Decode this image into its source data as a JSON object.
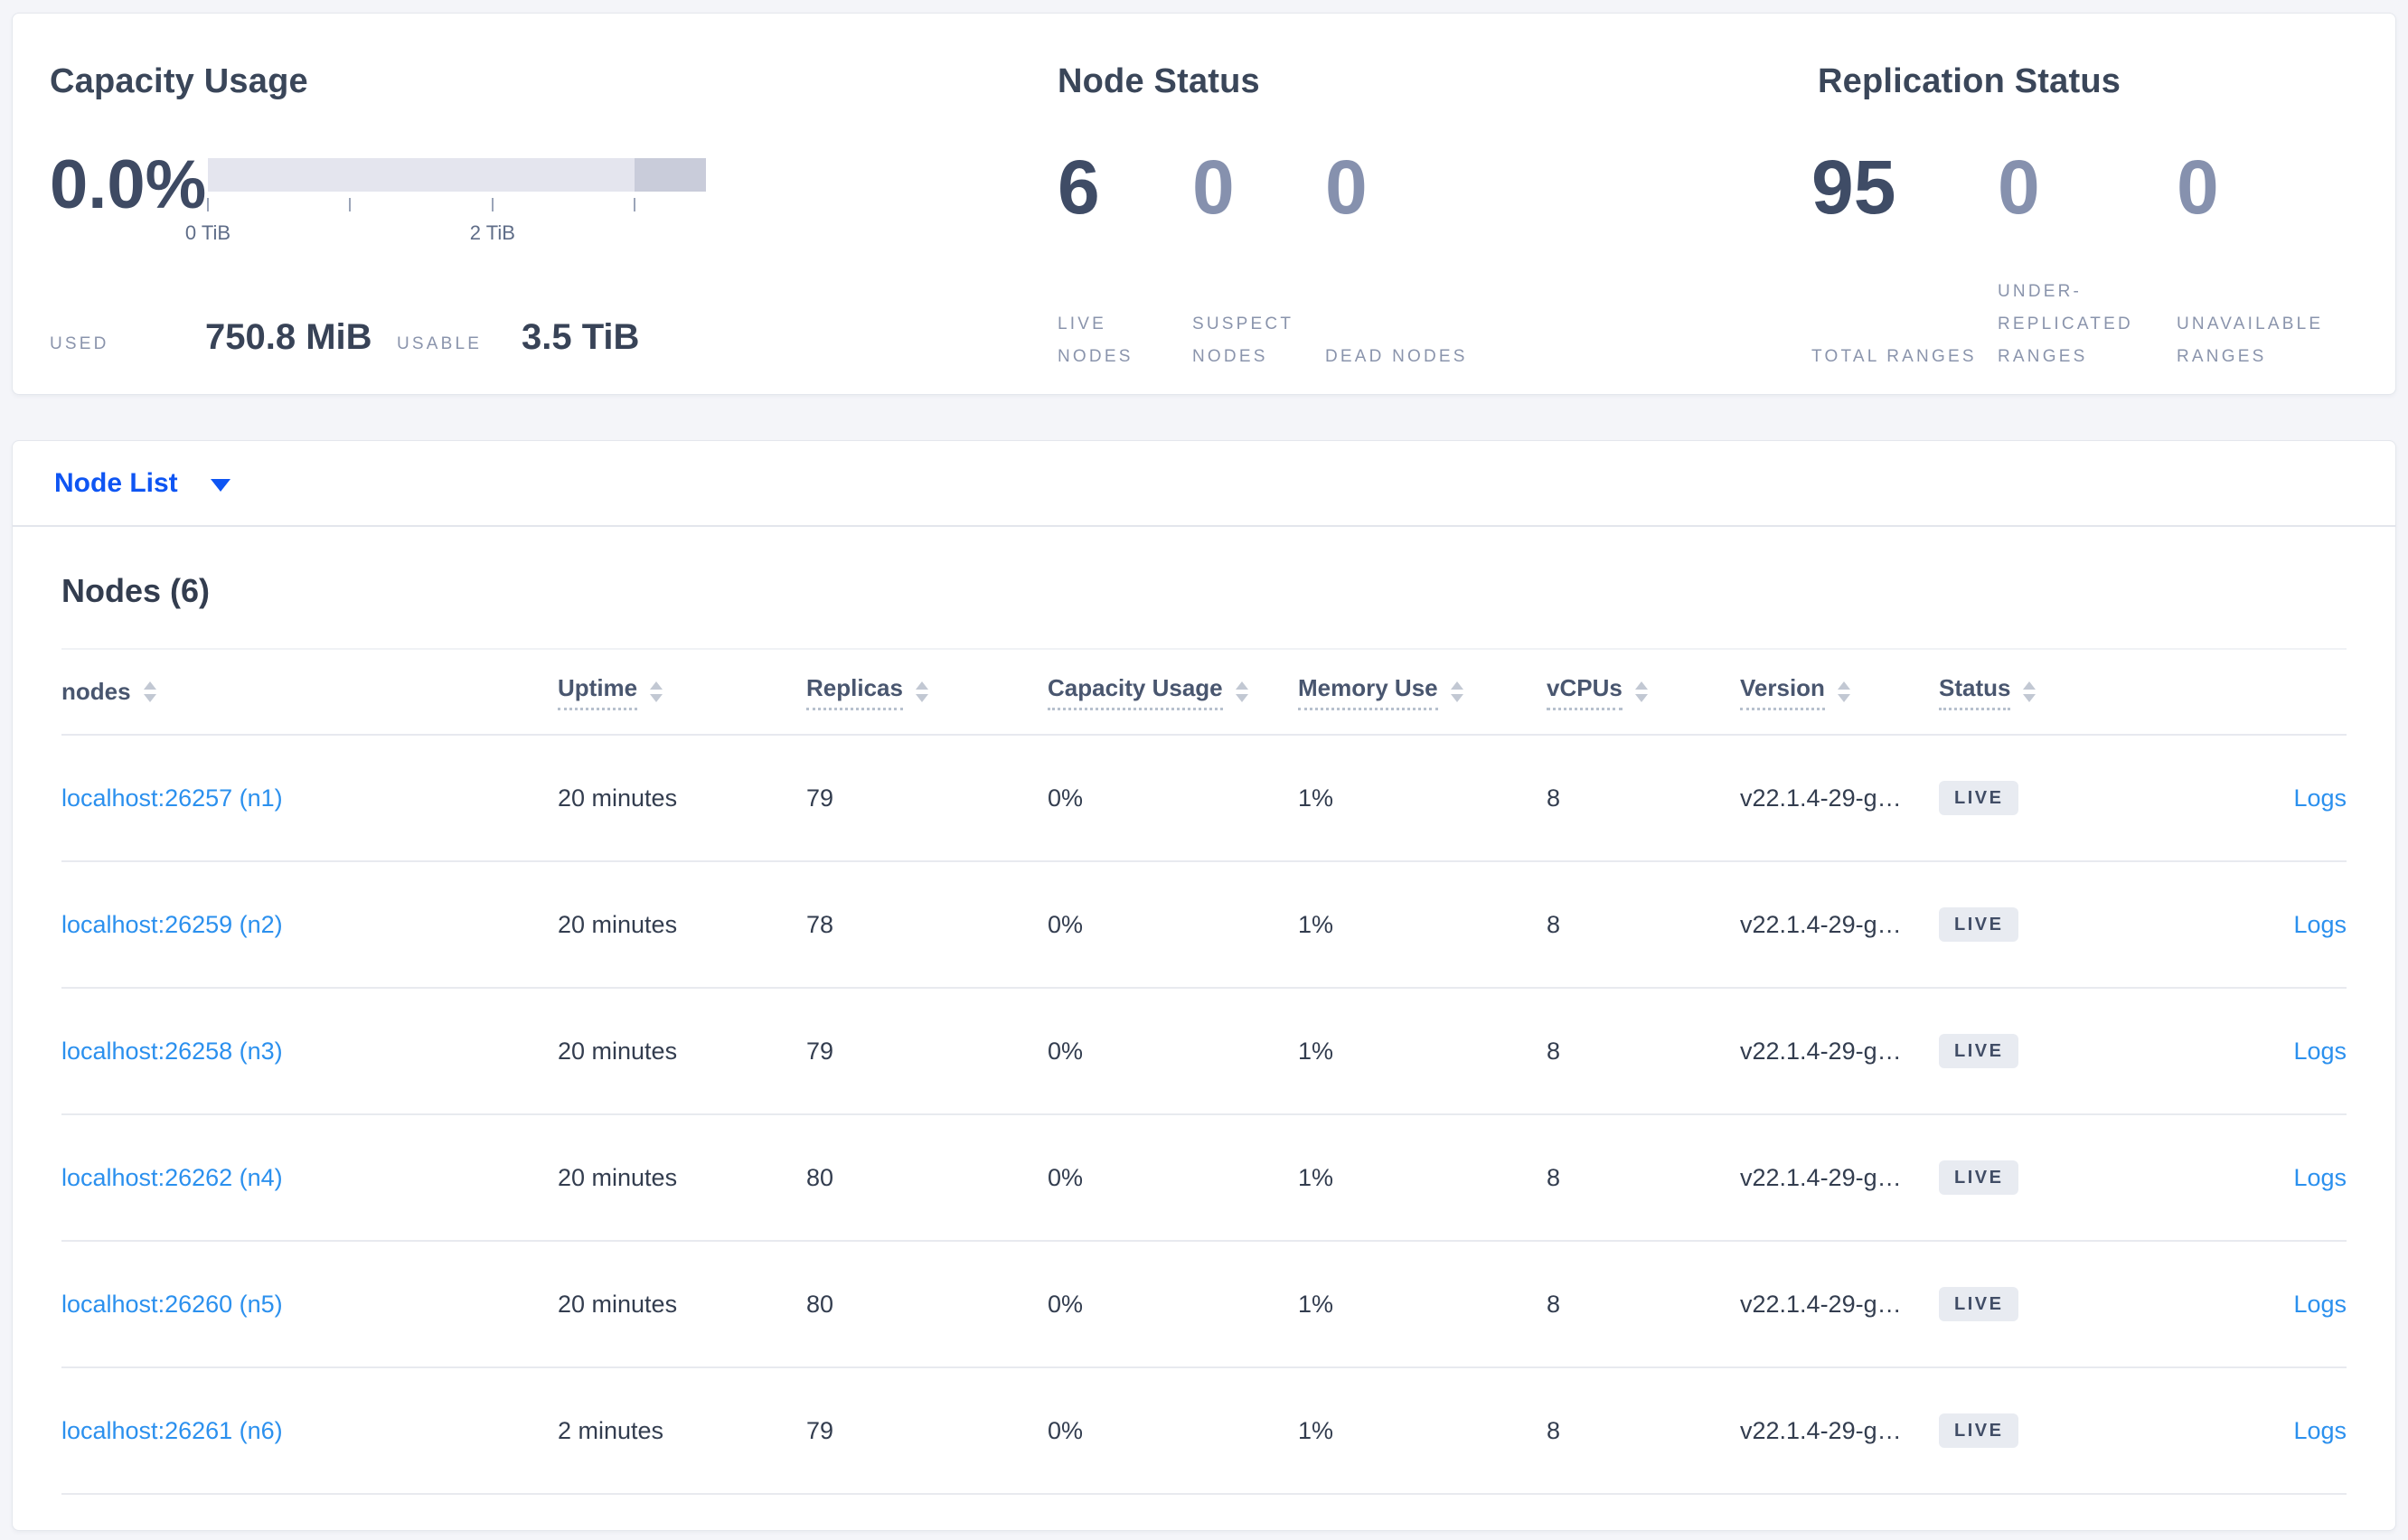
{
  "colors": {
    "accent_blue": "#0e55f3",
    "link_blue": "#2b90ee",
    "dark_number": "#3f4c66",
    "light_number": "#8691ae",
    "gauge_track": "#e4e5ee",
    "gauge_extra": "#c9ccda",
    "badge_bg": "#e8ebf1",
    "badge_text": "#414d66"
  },
  "summary": {
    "capacity": {
      "title": "Capacity Usage",
      "percent": "0.0%",
      "gauge": {
        "total_tib": 3.5,
        "extra_from_tib": 3.0,
        "ticks": [
          {
            "tib": 0,
            "label": "0 TiB"
          },
          {
            "tib": 1,
            "label": ""
          },
          {
            "tib": 2,
            "label": "2 TiB"
          },
          {
            "tib": 3,
            "label": ""
          }
        ]
      },
      "used_label": "USED",
      "used_value": "750.8 MiB",
      "usable_label": "USABLE",
      "usable_value": "3.5 TiB"
    },
    "node_status": {
      "title": "Node Status",
      "metrics": [
        {
          "value": "6",
          "label": "LIVE NODES",
          "emphasis": "dark"
        },
        {
          "value": "0",
          "label": "SUSPECT NODES",
          "emphasis": "light"
        },
        {
          "value": "0",
          "label": "DEAD NODES",
          "emphasis": "light"
        }
      ]
    },
    "replication_status": {
      "title": "Replication Status",
      "metrics": [
        {
          "value": "95",
          "label": "TOTAL RANGES",
          "emphasis": "dark"
        },
        {
          "value": "0",
          "label": "UNDER-REPLICATED RANGES",
          "emphasis": "light"
        },
        {
          "value": "0",
          "label": "UNAVAILABLE RANGES",
          "emphasis": "light"
        }
      ]
    }
  },
  "view_selector": {
    "label": "Node List"
  },
  "table": {
    "title": "Nodes (6)",
    "logs_label": "Logs",
    "columns": [
      {
        "label": "nodes",
        "underlined": false
      },
      {
        "label": "Uptime",
        "underlined": true
      },
      {
        "label": "Replicas",
        "underlined": true
      },
      {
        "label": "Capacity Usage",
        "underlined": true
      },
      {
        "label": "Memory Use",
        "underlined": true
      },
      {
        "label": "vCPUs",
        "underlined": true
      },
      {
        "label": "Version",
        "underlined": true
      },
      {
        "label": "Status",
        "underlined": true
      }
    ],
    "rows": [
      {
        "node": "localhost:26257 (n1)",
        "uptime": "20 minutes",
        "replicas": "79",
        "capacity": "0%",
        "memory": "1%",
        "vcpus": "8",
        "version": "v22.1.4-29-g…",
        "status": "LIVE"
      },
      {
        "node": "localhost:26259 (n2)",
        "uptime": "20 minutes",
        "replicas": "78",
        "capacity": "0%",
        "memory": "1%",
        "vcpus": "8",
        "version": "v22.1.4-29-g…",
        "status": "LIVE"
      },
      {
        "node": "localhost:26258 (n3)",
        "uptime": "20 minutes",
        "replicas": "79",
        "capacity": "0%",
        "memory": "1%",
        "vcpus": "8",
        "version": "v22.1.4-29-g…",
        "status": "LIVE"
      },
      {
        "node": "localhost:26262 (n4)",
        "uptime": "20 minutes",
        "replicas": "80",
        "capacity": "0%",
        "memory": "1%",
        "vcpus": "8",
        "version": "v22.1.4-29-g…",
        "status": "LIVE"
      },
      {
        "node": "localhost:26260 (n5)",
        "uptime": "20 minutes",
        "replicas": "80",
        "capacity": "0%",
        "memory": "1%",
        "vcpus": "8",
        "version": "v22.1.4-29-g…",
        "status": "LIVE"
      },
      {
        "node": "localhost:26261 (n6)",
        "uptime": "2 minutes",
        "replicas": "79",
        "capacity": "0%",
        "memory": "1%",
        "vcpus": "8",
        "version": "v22.1.4-29-g…",
        "status": "LIVE"
      }
    ]
  }
}
